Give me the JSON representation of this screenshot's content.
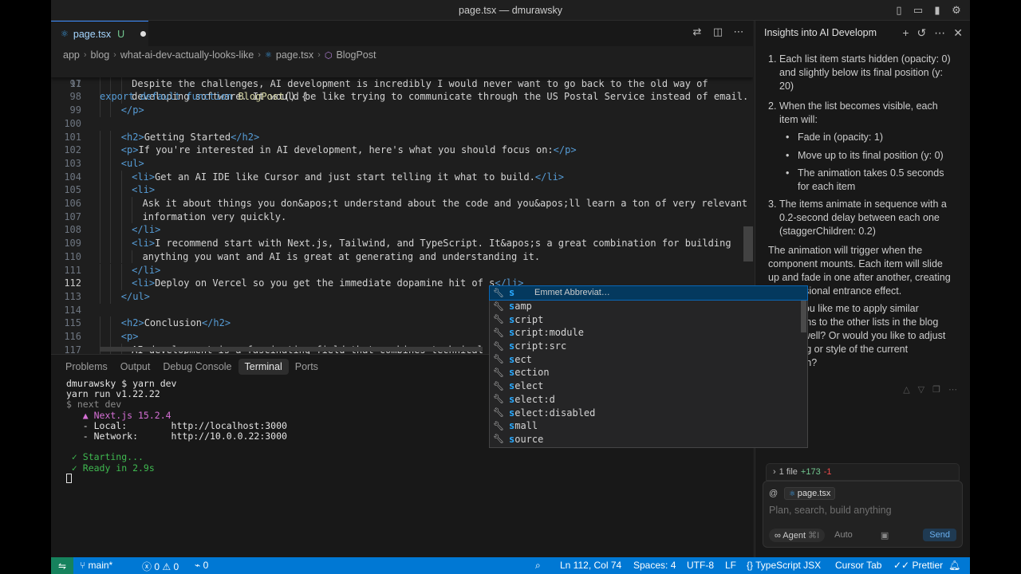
{
  "window": {
    "title": "page.tsx — dmurawsky"
  },
  "editor": {
    "tab": {
      "lang": "TSX",
      "filename": "page.tsx",
      "status": "U"
    },
    "breadcrumb": [
      "app",
      "blog",
      "what-ai-dev-actually-looks-like",
      "page.tsx",
      "BlogPost"
    ],
    "sticky": {
      "num": "11",
      "kw1": "export",
      "kw2": "default",
      "kw3": "function",
      "fn": "BlogPost",
      "rest": "() {"
    },
    "lines": [
      {
        "num": "97",
        "indent": 3,
        "parts": [
          [
            "txt",
            "Despite the challenges, AI development is incredibly I would never want to go back to the old way of"
          ]
        ]
      },
      {
        "num": "98",
        "indent": 3,
        "parts": [
          [
            "txt",
            "developing software. It would be like trying to communicate through the US Postal Service instead of email."
          ]
        ]
      },
      {
        "num": "99",
        "indent": 2,
        "parts": [
          [
            "tag",
            "</p>"
          ]
        ]
      },
      {
        "num": "100",
        "indent": 0,
        "parts": []
      },
      {
        "num": "101",
        "indent": 2,
        "parts": [
          [
            "tag",
            "<h2>"
          ],
          [
            "txt",
            "Getting Started"
          ],
          [
            "tag",
            "</h2>"
          ]
        ]
      },
      {
        "num": "102",
        "indent": 2,
        "parts": [
          [
            "tag",
            "<p>"
          ],
          [
            "txt",
            "If you're interested in AI development, here's what you should focus on:"
          ],
          [
            "tag",
            "</p>"
          ]
        ]
      },
      {
        "num": "103",
        "indent": 2,
        "parts": [
          [
            "tag",
            "<ul>"
          ]
        ]
      },
      {
        "num": "104",
        "indent": 3,
        "parts": [
          [
            "tag",
            "<li>"
          ],
          [
            "txt",
            "Get an AI IDE like Cursor and just start telling it what to build."
          ],
          [
            "tag",
            "</li>"
          ]
        ]
      },
      {
        "num": "105",
        "indent": 3,
        "parts": [
          [
            "tag",
            "<li>"
          ]
        ]
      },
      {
        "num": "106",
        "indent": 4,
        "parts": [
          [
            "txt",
            "Ask it about things you don&apos;t understand about the code and you&apos;ll learn a ton of very relevant"
          ]
        ]
      },
      {
        "num": "107",
        "indent": 4,
        "parts": [
          [
            "txt",
            "information very quickly."
          ]
        ]
      },
      {
        "num": "108",
        "indent": 3,
        "parts": [
          [
            "tag",
            "</li>"
          ]
        ]
      },
      {
        "num": "109",
        "indent": 3,
        "parts": [
          [
            "tag",
            "<li>"
          ],
          [
            "txt",
            "I recommend start with Next.js, Tailwind, and TypeScript. It&apos;s a great combination for building"
          ]
        ]
      },
      {
        "num": "110",
        "indent": 4,
        "parts": [
          [
            "txt",
            "anything you want and AI is great at generating and understanding it."
          ]
        ]
      },
      {
        "num": "111",
        "indent": 3,
        "parts": [
          [
            "tag",
            "</li>"
          ]
        ]
      },
      {
        "num": "112",
        "indent": 3,
        "active": true,
        "parts": [
          [
            "tag",
            "<li>"
          ],
          [
            "txt",
            "Deploy on Vercel so you get the immediate dopamine hit of s"
          ],
          [
            "tag",
            "</li>"
          ]
        ]
      },
      {
        "num": "113",
        "indent": 2,
        "parts": [
          [
            "tag",
            "</ul>"
          ]
        ]
      },
      {
        "num": "114",
        "indent": 0,
        "parts": []
      },
      {
        "num": "115",
        "indent": 2,
        "parts": [
          [
            "tag",
            "<h2>"
          ],
          [
            "txt",
            "Conclusion"
          ],
          [
            "tag",
            "</h2>"
          ]
        ]
      },
      {
        "num": "116",
        "indent": 2,
        "parts": [
          [
            "tag",
            "<p>"
          ]
        ]
      },
      {
        "num": "117",
        "indent": 3,
        "parts": [
          [
            "txt",
            "AI development is a fascinating field that combines technical s"
          ]
        ]
      }
    ]
  },
  "suggest": {
    "detail": "Emmet Abbreviat…",
    "items": [
      "s",
      "samp",
      "script",
      "script:module",
      "script:src",
      "sect",
      "section",
      "select",
      "select:d",
      "select:disabled",
      "small",
      "source"
    ]
  },
  "panel": {
    "tabs": [
      "Problems",
      "Output",
      "Debug Console",
      "Terminal",
      "Ports"
    ],
    "active_tab": "Terminal",
    "terminal": [
      {
        "cls": "t-white",
        "text": "dmurawsky $ yarn dev"
      },
      {
        "cls": "t-white",
        "text": "yarn run v1.22.22"
      },
      {
        "cls": "t-dim",
        "text": "$ next dev"
      },
      {
        "cls": "t-mag",
        "text": "   ▲ Next.js 15.2.4"
      },
      {
        "cls": "t-white",
        "text": "   - Local:        http://localhost:3000"
      },
      {
        "cls": "t-white",
        "text": "   - Network:      http://10.0.0.22:3000"
      },
      {
        "cls": "t-white",
        "text": ""
      },
      {
        "cls": "t-green",
        "text": " ✓ Starting..."
      },
      {
        "cls": "t-green",
        "text": " ✓ Ready in 2.9s"
      }
    ]
  },
  "chat": {
    "tab_title": "Insights into AI Developm",
    "items": [
      {
        "n": "1.",
        "text": "Each list item starts hidden (opacity: 0) and slightly below its final position (y: 20)"
      },
      {
        "n": "2.",
        "text": "When the list becomes visible, each item will:"
      },
      {
        "b": true,
        "text": "Fade in (opacity: 1)"
      },
      {
        "b": true,
        "text": "Move up to its final position (y: 0)"
      },
      {
        "b": true,
        "text": "The animation takes 0.5 seconds for each item"
      },
      {
        "n": "3.",
        "text": "The items animate in sequence with a 0.2-second delay between each one (staggerChildren: 0.2)"
      }
    ],
    "para1": "The animation will trigger when the component mounts. Each item will slide up and fade in one after another, creating a professional entrance effect.",
    "para2": "Would you like me to apply similar animations to the other lists in the blog post as well? Or would you like to adjust the timing or style of the current animation?",
    "changes": {
      "files": "1 file",
      "added": "+173",
      "removed": "-1"
    },
    "composer": {
      "context_file": "page.tsx",
      "placeholder": "Plan, search, build anything",
      "agent": "Agent",
      "shortcut": "⌘I",
      "mode": "Auto",
      "send": "Send"
    }
  },
  "statusbar": {
    "branch": "main*",
    "errors": "0",
    "warnings": "0",
    "ports": "0",
    "position": "Ln 112, Col 74",
    "spaces": "Spaces: 4",
    "encoding": "UTF-8",
    "eol": "LF",
    "language": "TypeScript JSX",
    "tab_mode": "Cursor Tab",
    "formatter": "Prettier"
  },
  "colors": {
    "accent": "#0078d4",
    "remote": "#16825d",
    "tag": "#569cd6",
    "highlight": "#2aaaff"
  }
}
